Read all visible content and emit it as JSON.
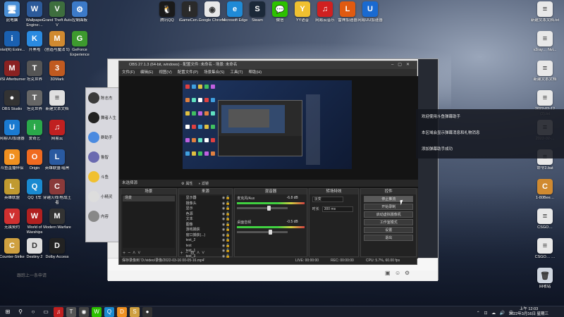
{
  "desktop_left": [
    {
      "label": "此电脑",
      "color": "#4a8fd6",
      "glyph": "🖥"
    },
    {
      "label": "Wallpaper Engine:...",
      "color": "#2c5a9a",
      "glyph": "W"
    },
    {
      "label": "Grand Theft Auto V",
      "color": "#3e6e3e",
      "glyph": "V"
    },
    {
      "label": "控制面板",
      "color": "#3c7ac8",
      "glyph": "⚙"
    },
    {
      "label": "Intel(R) Extre...",
      "color": "#1a60b0",
      "glyph": "i"
    },
    {
      "label": "开黑啦",
      "color": "#2a8ae0",
      "glyph": "K"
    },
    {
      "label": "(创造与魔法 5)",
      "color": "#d08a30",
      "glyph": "M"
    },
    {
      "label": "GeForce Experience",
      "color": "#3d9a2e",
      "glyph": "G"
    },
    {
      "label": "MSI Afterburner",
      "color": "#8a2222",
      "glyph": "M"
    },
    {
      "label": "坦克世界",
      "color": "#555",
      "glyph": "T"
    },
    {
      "label": "3DMark",
      "color": "#c05a20",
      "glyph": "3"
    },
    {
      "label": "CPUID CPU-Z MSI",
      "color": "#c03030",
      "glyph": "C"
    },
    {
      "label": "OBS Studio",
      "color": "#333",
      "glyph": "●"
    },
    {
      "label": "坦克世界",
      "color": "#666",
      "glyph": "T"
    },
    {
      "label": "新建文本文档",
      "color": "#e0e0e0",
      "glyph": "≡"
    },
    {
      "label": "Apex Legends",
      "color": "#b02020",
      "glyph": "A"
    },
    {
      "label": "网易UU加速器",
      "color": "#1a7ad0",
      "glyph": "U"
    },
    {
      "label": "爱奇艺",
      "color": "#2aa84a",
      "glyph": "i"
    },
    {
      "label": "网易云",
      "color": "#c02020",
      "glyph": "♫"
    },
    {
      "label": "WeGame",
      "color": "#1e6ad0",
      "glyph": "W"
    },
    {
      "label": "斗鱼直播伴侣",
      "color": "#f09020",
      "glyph": "D"
    },
    {
      "label": "Origin",
      "color": "#f06a20",
      "glyph": "O"
    },
    {
      "label": "英雄联盟-暗黑",
      "color": "#2a5aa0",
      "glyph": "L"
    },
    {
      "label": "穿越火线",
      "color": "#334",
      "glyph": "C"
    },
    {
      "label": "英雄联盟",
      "color": "#c09a30",
      "glyph": "L"
    },
    {
      "label": "QQ飞车",
      "color": "#1a8ad0",
      "glyph": "Q"
    },
    {
      "label": "穿越火线:枪战王者",
      "color": "#8a3a3a",
      "glyph": "C"
    },
    {
      "label": "守望先锋",
      "color": "#e08020",
      "glyph": "O"
    },
    {
      "label": "无畏契约",
      "color": "#d03030",
      "glyph": "V"
    },
    {
      "label": "World of Warships",
      "color": "#b02020",
      "glyph": "W"
    },
    {
      "label": "Modern Warfare",
      "color": "#333",
      "glyph": "M"
    },
    {
      "label": "网易 Steam伴侣",
      "color": "#222",
      "glyph": "S"
    },
    {
      "label": "Counter-Strike",
      "color": "#cfa040",
      "glyph": "C"
    },
    {
      "label": "Destiny 2",
      "color": "#ddd",
      "glyph": "D"
    },
    {
      "label": "Dolby Access",
      "color": "#222",
      "glyph": "D"
    }
  ],
  "desktop_top": [
    {
      "label": "腾讯QQ",
      "color": "#1a1a1a",
      "glyph": "🐧"
    },
    {
      "label": "iGameCen...",
      "color": "#2a2a2a",
      "glyph": "i"
    },
    {
      "label": "Google Chrome",
      "color": "#e8e8e8",
      "glyph": "◉"
    },
    {
      "label": "Microsoft Edge",
      "color": "#1f8ad6",
      "glyph": "e"
    },
    {
      "label": "Steam",
      "color": "#1b2838",
      "glyph": "S"
    },
    {
      "label": "微信",
      "color": "#2dc100",
      "glyph": "💬"
    },
    {
      "label": "YY语音",
      "color": "#f0c030",
      "glyph": "Y"
    },
    {
      "label": "网易云音乐",
      "color": "#d02020",
      "glyph": "♫"
    },
    {
      "label": "雷神加速器",
      "color": "#e05a10",
      "glyph": "L"
    },
    {
      "label": "网易UU加速器",
      "color": "#1a6ad0",
      "glyph": "U"
    }
  ],
  "desktop_right": [
    {
      "label": "新建文本文档.txt",
      "color": "#e8e8e8",
      "glyph": "≡"
    },
    {
      "label": "v2ray… Nvi...",
      "color": "#e8e8e8",
      "glyph": "≡"
    },
    {
      "label": "新建文本文档",
      "color": "#e8e8e8",
      "glyph": "≡"
    },
    {
      "label": "2022-02-12 (2).txt",
      "color": "#e8e8e8",
      "glyph": "≡"
    },
    {
      "label": "2022-02-...",
      "color": "#e8e8e8",
      "glyph": "≡"
    },
    {
      "label": "命令2.bat",
      "color": "#e8e8e8",
      "glyph": "≡"
    },
    {
      "label": "1-80Bee…",
      "color": "#d08a30",
      "glyph": "C"
    },
    {
      "label": "CSGO…",
      "color": "#e8e8e8",
      "glyph": "≡"
    },
    {
      "label": "CSGO… …",
      "color": "#e8e8e8",
      "glyph": "≡"
    },
    {
      "label": "回收站",
      "color": "#cfd6e0",
      "glyph": "🗑"
    }
  ],
  "chat": {
    "input_placeholder": "跟踪上一条申请",
    "contacts": [
      {
        "name": "陈志杰",
        "color": "#3a3a3a"
      },
      {
        "name": "舞者人生",
        "color": "#222"
      },
      {
        "name": "群助手",
        "color": "#4a8ae0"
      },
      {
        "name": "鲁智",
        "color": "#6a6ab0"
      },
      {
        "name": "斗鱼",
        "color": "#f0c030"
      },
      {
        "name": "小精灵",
        "color": "#ddd"
      },
      {
        "name": "内容",
        "color": "#888"
      }
    ]
  },
  "obs": {
    "title": "OBS 27.1.3 (64-bit, windows) - 配置文件: 未命名 - 场景: 未命名",
    "menu": [
      "文件(F)",
      "编辑(E)",
      "视图(V)",
      "配置文件(P)",
      "场景集合(S)",
      "工具(T)",
      "帮助(H)"
    ],
    "no_source_label": "未选择源",
    "scene_bar_props": "属性",
    "scene_bar_filter": "滤镜",
    "docks": {
      "scenes": {
        "title": "场景",
        "items": [
          "场景"
        ]
      },
      "sources": {
        "title": "来源",
        "items": [
          "显示器",
          "摄像头",
          "显示",
          "色源",
          "文本",
          "图像",
          "游戏捕获",
          "窗口捕获(...)",
          "text_2",
          "text",
          "text_1",
          "text_3",
          "媒体"
        ]
      },
      "mixer": {
        "title": "混音器",
        "channels": [
          {
            "name": "麦克风/Aux",
            "db": "-6.8 dB"
          },
          {
            "name": "桌面音频",
            "db": "-0.5 dB"
          }
        ]
      },
      "transitions": {
        "title": "转场特效",
        "type": "淡变",
        "duration_label": "时长",
        "duration": "300 ms"
      },
      "controls": {
        "title": "控件",
        "buttons": [
          "停止推流",
          "开始录制",
          "启动虚拟摄像机",
          "工作室模式",
          "设置",
          "退出"
        ]
      }
    },
    "status": {
      "message": "保存录像到 'D:/video/录像/2022-03-16 00-05-16.mp4'",
      "live": "LIVE: 00:00:00",
      "rec": "REC: 00:00:00",
      "cpu": "CPU: 5.7%, 60.00 fps"
    }
  },
  "notifications": [
    "欢迎使用斗鱼弹幕助手",
    "本区域会显示弹幕消息和礼物消息",
    "添加弹幕助手成功"
  ],
  "taskbar": {
    "time": "上午 12:03",
    "date": "2022年3月16日 星期三",
    "items": [
      {
        "name": "start-icon",
        "glyph": "⊞",
        "color": "#1a1f2c"
      },
      {
        "name": "search-icon",
        "glyph": "⚲",
        "color": "#1a1f2c"
      },
      {
        "name": "cortana-icon",
        "glyph": "○",
        "color": "#1a1f2c"
      },
      {
        "name": "taskview-icon",
        "glyph": "▭",
        "color": "#1a1f2c"
      },
      {
        "name": "netease-icon",
        "glyph": "♫",
        "color": "#c02020"
      },
      {
        "name": "wot-icon",
        "glyph": "T",
        "color": "#555"
      },
      {
        "name": "chrome-icon",
        "glyph": "◉",
        "color": "#444"
      },
      {
        "name": "wechat-icon",
        "glyph": "W",
        "color": "#2dc100"
      },
      {
        "name": "qq-icon",
        "glyph": "Q",
        "color": "#1a8ad0"
      },
      {
        "name": "douyu-icon",
        "glyph": "D",
        "color": "#f09020"
      },
      {
        "name": "ss-icon",
        "glyph": "S",
        "color": "#cfa040"
      },
      {
        "name": "obs-icon",
        "glyph": "●",
        "color": "#333"
      }
    ]
  }
}
